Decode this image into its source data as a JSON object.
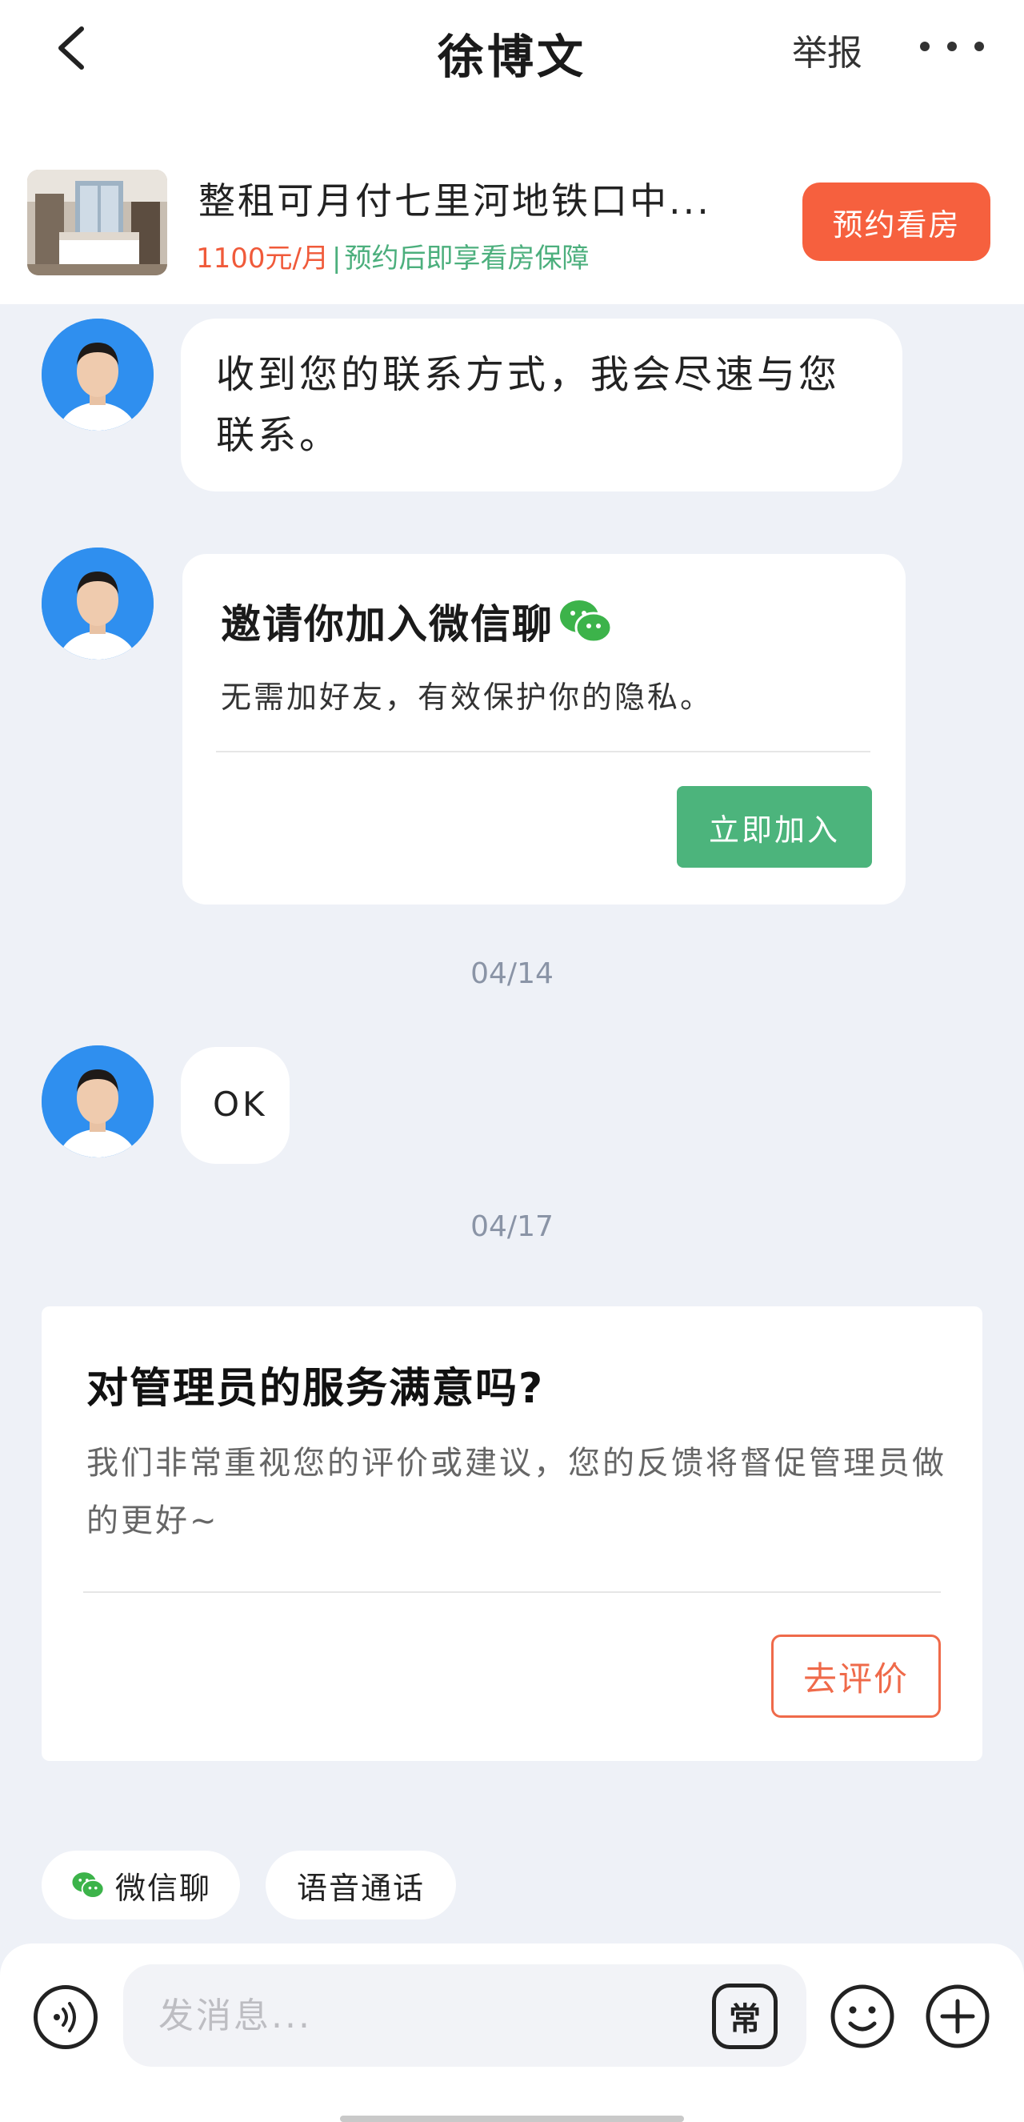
{
  "header": {
    "title": "徐博文",
    "report_label": "举报"
  },
  "listing": {
    "title": "整租可月付七里河地铁口中...",
    "price": "1100元/月",
    "separator": "|",
    "guarantee": "预约后即享看房保障",
    "book_button": "预约看房"
  },
  "messages": {
    "contact_reply": "收到您的联系方式，我会尽速与您联系。",
    "wechat_card": {
      "title": "邀请你加入微信聊",
      "desc": "无需加好友，有效保护你的隐私。",
      "button": "立即加入"
    },
    "date_1": "04/14",
    "ok_reply": "OK",
    "date_2": "04/17"
  },
  "survey": {
    "title": "对管理员的服务满意吗?",
    "desc": "我们非常重视您的评价或建议，您的反馈将督促管理员做的更好~",
    "button": "去评价"
  },
  "quick_actions": {
    "wechat": "微信聊",
    "voice_call": "语音通话"
  },
  "composer": {
    "placeholder": "发消息...",
    "common_phrases": "常"
  },
  "colors": {
    "accent_orange": "#f6603e",
    "accent_green": "#4cb47c",
    "background": "#eef1f7"
  }
}
